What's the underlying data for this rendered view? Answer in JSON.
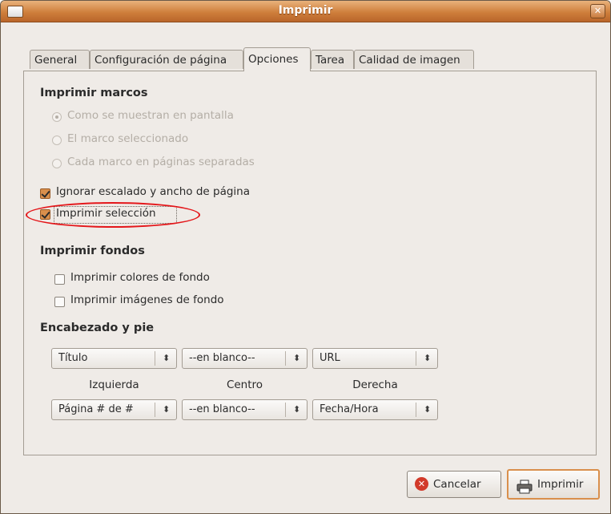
{
  "window": {
    "title": "Imprimir"
  },
  "tabs": [
    {
      "label": "General"
    },
    {
      "label": "Configuración de página"
    },
    {
      "label": "Opciones",
      "active": true
    },
    {
      "label": "Tarea"
    },
    {
      "label": "Calidad de imagen"
    }
  ],
  "frames": {
    "heading": "Imprimir marcos",
    "options": [
      {
        "label": "Como se muestran en pantalla",
        "selected": true,
        "enabled": false
      },
      {
        "label": "El marco seleccionado",
        "selected": false,
        "enabled": false
      },
      {
        "label": "Cada marco en páginas separadas",
        "selected": false,
        "enabled": false
      }
    ]
  },
  "checks": {
    "ignore_scaling": {
      "label": "Ignorar escalado y ancho de página",
      "checked": true
    },
    "print_selection": {
      "label": "Imprimir selección",
      "checked": true
    }
  },
  "backgrounds": {
    "heading": "Imprimir fondos",
    "colors": {
      "label": "Imprimir colores de fondo",
      "checked": false
    },
    "images": {
      "label": "Imprimir imágenes de fondo",
      "checked": false
    }
  },
  "header_footer": {
    "heading": "Encabezado y pie",
    "header": {
      "left": "Título",
      "center": "--en blanco--",
      "right": "URL"
    },
    "captions": {
      "left": "Izquierda",
      "center": "Centro",
      "right": "Derecha"
    },
    "footer": {
      "left": "Página # de #",
      "center": "--en blanco--",
      "right": "Fecha/Hora"
    }
  },
  "buttons": {
    "cancel": "Cancelar",
    "print": "Imprimir"
  },
  "colors": {
    "titlebar": "#cf7f3c",
    "highlight": "#e4161a",
    "check_accent": "#d98f4c"
  }
}
